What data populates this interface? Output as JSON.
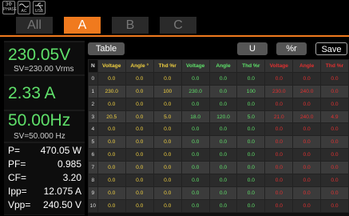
{
  "status_icons": [
    {
      "name": "three-phase-icon",
      "label": "PHASE",
      "top": "3Φ"
    },
    {
      "name": "ac-wave-icon",
      "label": "AC"
    },
    {
      "name": "usb-icon",
      "label": "USB"
    }
  ],
  "tabs": [
    "All",
    "A",
    "B",
    "C"
  ],
  "active_tab": "A",
  "readings": {
    "voltage": "230.05V",
    "sv_voltage": "SV=230.00 Vrms",
    "current": "2.33 A",
    "frequency": "50.00Hz",
    "sv_frequency": "SV=50.000  Hz",
    "params": [
      {
        "label": "P=",
        "value": "470.05 W"
      },
      {
        "label": "PF=",
        "value": "0.985"
      },
      {
        "label": "CF=",
        "value": "3.20"
      },
      {
        "label": "Ipp=",
        "value": "12.075 A"
      },
      {
        "label": "Vpp=",
        "value": "240.50 V"
      }
    ]
  },
  "toolbar": {
    "table_label": "Table",
    "u_label": "U",
    "pct_label": "%r",
    "save_label": "Save"
  },
  "table": {
    "headers": [
      {
        "text": "N",
        "group": "idx"
      },
      {
        "text": "Voltage",
        "group": "v"
      },
      {
        "text": "Angle °",
        "group": "v"
      },
      {
        "text": "Thd %r",
        "group": "v"
      },
      {
        "text": "Voltage",
        "group": "i"
      },
      {
        "text": "Angle",
        "group": "i"
      },
      {
        "text": "Thd %r",
        "group": "i"
      },
      {
        "text": "Voltage",
        "group": "p"
      },
      {
        "text": "Angle",
        "group": "p"
      },
      {
        "text": "Thd %r",
        "group": "p"
      }
    ],
    "rows": [
      [
        "0",
        "0.0",
        "0.0",
        "0.0",
        "0.0",
        "0.0",
        "0.0",
        "0.0",
        "0.0",
        "0.0"
      ],
      [
        "1",
        "230.0",
        "0.0",
        "100",
        "230.0",
        "0.0",
        "100",
        "230.0",
        "240.0",
        "0.0"
      ],
      [
        "2",
        "0.0",
        "0.0",
        "0.0",
        "0.0",
        "0.0",
        "0.0",
        "0.0",
        "0.0",
        "0.0"
      ],
      [
        "3",
        "20.5",
        "0.0",
        "5.0",
        "18.0",
        "120.0",
        "5.0",
        "21.0",
        "240.0",
        "4.9"
      ],
      [
        "4",
        "0.0",
        "0.0",
        "0.0",
        "0.0",
        "0.0",
        "0.0",
        "0.0",
        "0.0",
        "0.0"
      ],
      [
        "5",
        "0.0",
        "0.0",
        "0.0",
        "0.0",
        "0.0",
        "0.0",
        "0.0",
        "0.0",
        "0.0"
      ],
      [
        "6",
        "0.0",
        "0.0",
        "0.0",
        "0.0",
        "0.0",
        "0.0",
        "0.0",
        "0.0",
        "0.0"
      ],
      [
        "7",
        "0.0",
        "0.0",
        "0.0",
        "0.0",
        "0.0",
        "0.0",
        "0.0",
        "0.0",
        "0.0"
      ],
      [
        "8",
        "0.0",
        "0.0",
        "0.0",
        "0.0",
        "0.0",
        "0.0",
        "0.0",
        "0.0",
        "0.0"
      ],
      [
        "9",
        "0.0",
        "0.0",
        "0.0",
        "0.0",
        "0.0",
        "0.0",
        "0.0",
        "0.0",
        "0.0"
      ],
      [
        "10",
        "0.0",
        "0.0",
        "0.0",
        "0.0",
        "0.0",
        "0.0",
        "0.0",
        "0.0",
        "0.0"
      ]
    ]
  },
  "colors": {
    "accent": "#f07a1e",
    "readout_green": "#5fe06a",
    "voltage_yellow": "#f0d040",
    "phase_red": "#e03030"
  }
}
